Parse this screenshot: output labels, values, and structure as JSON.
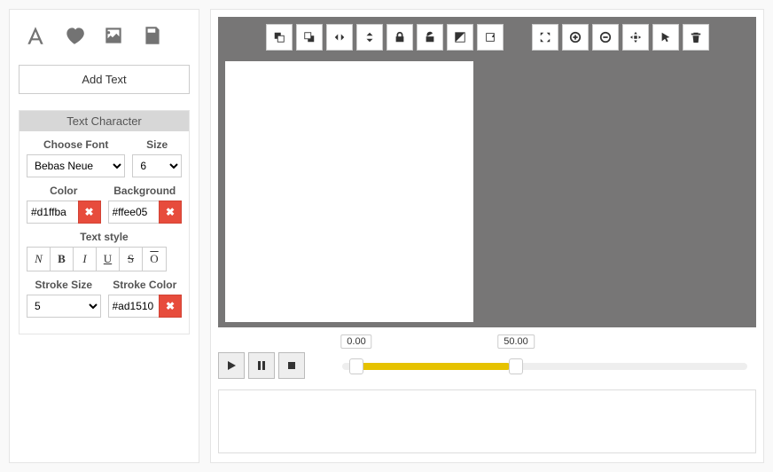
{
  "sidebar": {
    "add_text_label": "Add Text",
    "panel_title": "Text Character",
    "font": {
      "label": "Choose Font",
      "value": "Bebas Neue"
    },
    "size": {
      "label": "Size",
      "value": "6"
    },
    "color": {
      "label": "Color",
      "value": "#d1ffba"
    },
    "background": {
      "label": "Background",
      "value": "#ffee05"
    },
    "text_style_label": "Text style",
    "styles": {
      "normal": "N",
      "bold": "B",
      "italic": "I",
      "underline": "U",
      "strike": "S",
      "overline": "O"
    },
    "stroke_size": {
      "label": "Stroke Size",
      "value": "5"
    },
    "stroke_color": {
      "label": "Stroke Color",
      "value": "#ad1510"
    }
  },
  "timeline": {
    "start": "0.00",
    "end": "50.00"
  }
}
